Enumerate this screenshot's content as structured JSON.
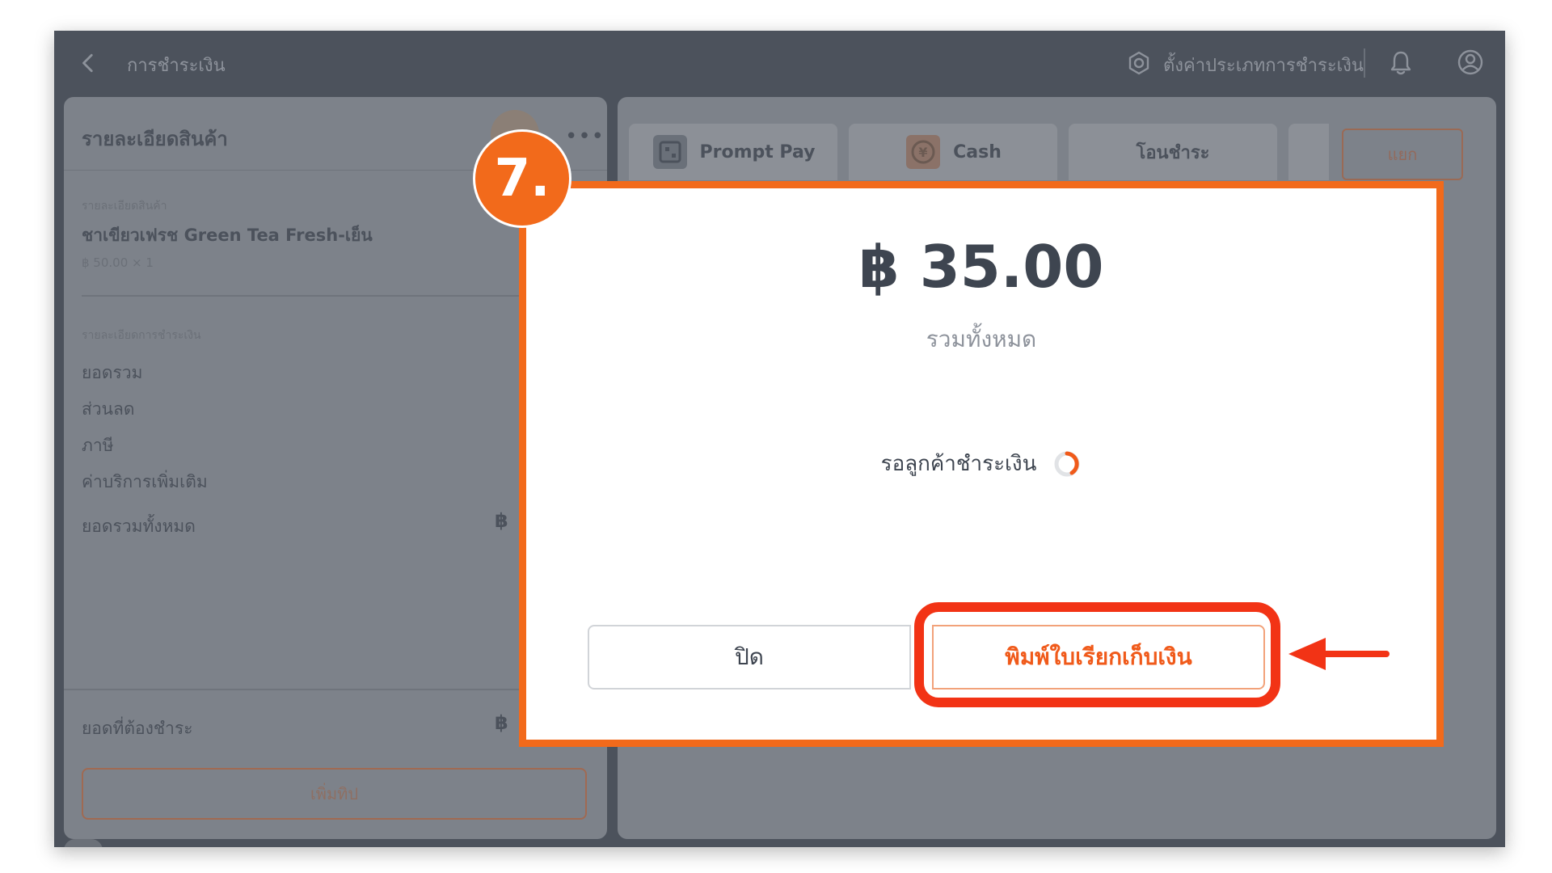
{
  "topbar": {
    "title": "การชำระเงิน",
    "settings_label": "ตั้งค่าประเภทการชำระเงิน",
    "icons": [
      "back-arrow-icon",
      "gear-icon",
      "bell-icon",
      "user-icon"
    ]
  },
  "left_panel": {
    "title": "รายละเอียดสินค้า",
    "product_caption": "รายละเอียดสินค้า",
    "product_name": "ชาเขียวเฟรช Green Tea Fresh-เย็น",
    "product_price": "฿ 50.00 × 1",
    "payment_caption": "รายละเอียดการชำระเงิน",
    "summary_rows": [
      "ยอดรวม",
      "ส่วนลด",
      "ภาษี",
      "ค่าบริการเพิ่มเติม",
      "ยอดรวมทั้งหมด"
    ],
    "total_currency": "฿",
    "due_label": "ยอดที่ต้องชำระ",
    "due_currency": "฿",
    "tip_button": "เพิ่มทิป"
  },
  "right_panel": {
    "tabs": [
      {
        "label": "Prompt Pay",
        "icon": "qr-icon"
      },
      {
        "label": "Cash",
        "icon": "coin-icon"
      },
      {
        "label": "โอนชำระ",
        "icon": ""
      }
    ],
    "split_button": "แยก"
  },
  "modal": {
    "amount": "฿ 35.00",
    "amount_label": "รวมทั้งหมด",
    "waiting_text": "รอลูกค้าชำระเงิน",
    "close_button": "ปิด",
    "print_button": "พิมพ์ใบเรียกเก็บเงิน"
  },
  "annotation": {
    "step": "7."
  },
  "colors": {
    "accent": "#f26a1b",
    "highlight": "#f23315",
    "overlay_bg": "#4c525c"
  }
}
